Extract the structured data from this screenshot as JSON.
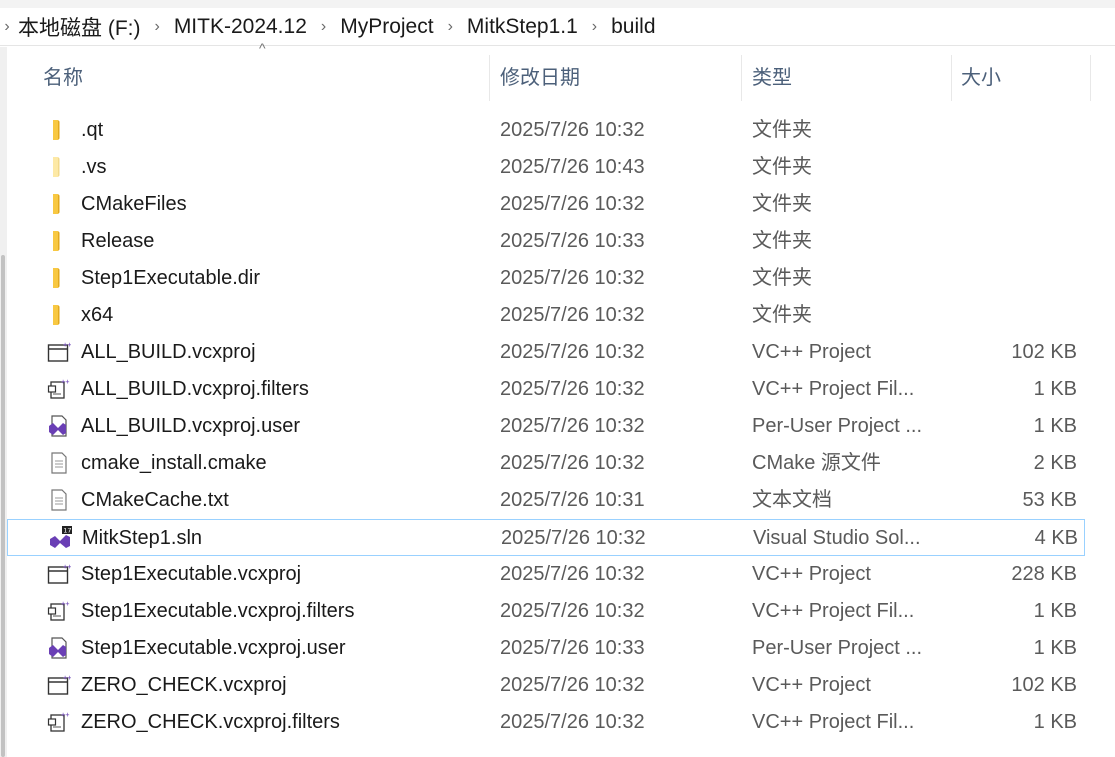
{
  "breadcrumb": [
    "本地磁盘 (F:)",
    "MITK-2024.12",
    "MyProject",
    "MitkStep1.1",
    "build"
  ],
  "columns": {
    "name": "名称",
    "modified": "修改日期",
    "type": "类型",
    "size": "大小"
  },
  "sort_indicator": "^",
  "files": [
    {
      "name": ".qt",
      "modified": "2025/7/26 10:32",
      "type": "文件夹",
      "size": "",
      "icon": "folder-icon"
    },
    {
      "name": ".vs",
      "modified": "2025/7/26 10:43",
      "type": "文件夹",
      "size": "",
      "icon": "hidden-folder-icon"
    },
    {
      "name": "CMakeFiles",
      "modified": "2025/7/26 10:32",
      "type": "文件夹",
      "size": "",
      "icon": "folder-icon"
    },
    {
      "name": "Release",
      "modified": "2025/7/26 10:33",
      "type": "文件夹",
      "size": "",
      "icon": "folder-icon"
    },
    {
      "name": "Step1Executable.dir",
      "modified": "2025/7/26 10:32",
      "type": "文件夹",
      "size": "",
      "icon": "folder-icon"
    },
    {
      "name": "x64",
      "modified": "2025/7/26 10:32",
      "type": "文件夹",
      "size": "",
      "icon": "folder-icon"
    },
    {
      "name": "ALL_BUILD.vcxproj",
      "modified": "2025/7/26 10:32",
      "type": "VC++ Project",
      "size": "102 KB",
      "icon": "vcxproj-icon"
    },
    {
      "name": "ALL_BUILD.vcxproj.filters",
      "modified": "2025/7/26 10:32",
      "type": "VC++ Project Fil...",
      "size": "1 KB",
      "icon": "vcxproj-filters-icon"
    },
    {
      "name": "ALL_BUILD.vcxproj.user",
      "modified": "2025/7/26 10:32",
      "type": "Per-User Project ...",
      "size": "1 KB",
      "icon": "vs-user-file-icon"
    },
    {
      "name": "cmake_install.cmake",
      "modified": "2025/7/26 10:32",
      "type": "CMake 源文件",
      "size": "2 KB",
      "icon": "text-file-icon"
    },
    {
      "name": "CMakeCache.txt",
      "modified": "2025/7/26 10:31",
      "type": "文本文档",
      "size": "53 KB",
      "icon": "text-file-icon"
    },
    {
      "name": "MitkStep1.sln",
      "modified": "2025/7/26 10:32",
      "type": "Visual Studio Sol...",
      "size": "4 KB",
      "icon": "visual-studio-solution-icon",
      "selected": true
    },
    {
      "name": "Step1Executable.vcxproj",
      "modified": "2025/7/26 10:32",
      "type": "VC++ Project",
      "size": "228 KB",
      "icon": "vcxproj-icon"
    },
    {
      "name": "Step1Executable.vcxproj.filters",
      "modified": "2025/7/26 10:32",
      "type": "VC++ Project Fil...",
      "size": "1 KB",
      "icon": "vcxproj-filters-icon"
    },
    {
      "name": "Step1Executable.vcxproj.user",
      "modified": "2025/7/26 10:33",
      "type": "Per-User Project ...",
      "size": "1 KB",
      "icon": "vs-user-file-icon"
    },
    {
      "name": "ZERO_CHECK.vcxproj",
      "modified": "2025/7/26 10:32",
      "type": "VC++ Project",
      "size": "102 KB",
      "icon": "vcxproj-icon"
    },
    {
      "name": "ZERO_CHECK.vcxproj.filters",
      "modified": "2025/7/26 10:32",
      "type": "VC++ Project Fil...",
      "size": "1 KB",
      "icon": "vcxproj-filters-icon"
    }
  ],
  "sln_badge": "17",
  "colors": {
    "folder": "#f8c842",
    "folder_light": "#fde9a6",
    "selection_border": "#99d1ff",
    "header_text": "#4c607a",
    "vs_purple": "#6a3fb5"
  }
}
